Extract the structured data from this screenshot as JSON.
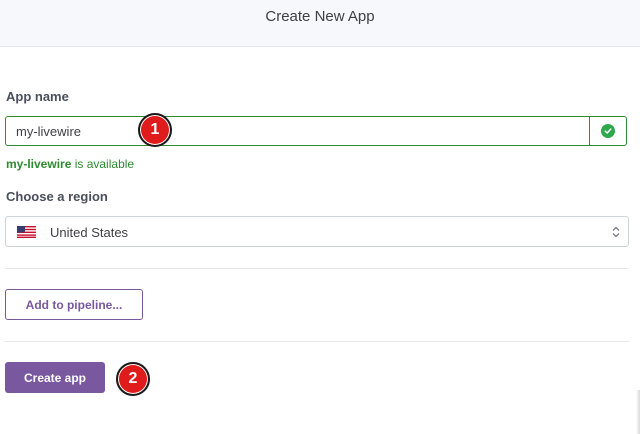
{
  "header": {
    "title": "Create New App"
  },
  "form": {
    "app_name_label": "App name",
    "app_name_value": "my-livewire",
    "availability": {
      "name": "my-livewire",
      "suffix": " is available"
    },
    "region_label": "Choose a region",
    "region_value": "United States",
    "pipeline_button": "Add to pipeline...",
    "create_button": "Create app"
  },
  "annotations": {
    "marker_1": "1",
    "marker_2": "2"
  },
  "colors": {
    "accent": "#79589f",
    "success": "#2e8b2e",
    "marker": "#e01b1b"
  },
  "icons": {
    "check": "check-circle-icon",
    "flag": "us-flag-icon",
    "select": "updown-chevron-icon"
  }
}
